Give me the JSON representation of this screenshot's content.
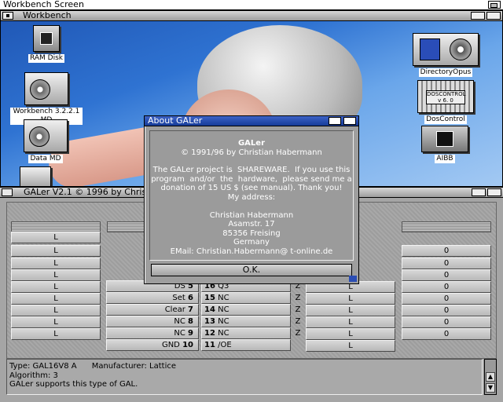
{
  "screen": {
    "title": "Workbench Screen"
  },
  "workbench": {
    "title": "Workbench",
    "icons": [
      {
        "label": "RAM Disk"
      },
      {
        "label": "Workbench 3.2.2.1 MD"
      },
      {
        "label": "Data MD"
      },
      {
        "label": "DirectoryOpus"
      },
      {
        "label": "DosControl"
      },
      {
        "label": "AIBB"
      }
    ],
    "doscontrol_text": "DOSCONTROL",
    "doscontrol_version": "v 6. 0"
  },
  "about": {
    "title": "About GALer",
    "heading": "GALer",
    "lines": [
      "© 1991/96 by Christian Habermann",
      "",
      "The GALer project is  SHAREWARE.  If you use this",
      "program  and/or  the  hardware,  please send me a",
      "donation of 15 US $ (see manual). Thank you!",
      "My address:",
      "",
      "Christian Habermann",
      "Asamstr. 17",
      "85356 Freising",
      "Germany",
      "EMail: Christian.Habermann@ t-online.de"
    ],
    "ok_label": "O.K."
  },
  "galer": {
    "title": "GALer V2.1  © 1996 by Christian Habermann",
    "left_values": [
      "L",
      "L",
      "L",
      "L",
      "L",
      "L",
      "L",
      "L",
      "L",
      "L"
    ],
    "right_values": [
      "0",
      "0",
      "0",
      "0",
      "0",
      "0",
      "0",
      "0"
    ],
    "mid_values": [
      "L",
      "L",
      "L",
      "L",
      "L"
    ],
    "pins_left": [
      {
        "name": "",
        "num": ""
      },
      {
        "name": "",
        "num": ""
      },
      {
        "name": "",
        "num": ""
      },
      {
        "name": "",
        "num": ""
      },
      {
        "name": "",
        "num": ""
      },
      {
        "name": "DS",
        "num": "5"
      },
      {
        "name": "Set",
        "num": "6"
      },
      {
        "name": "Clear",
        "num": "7"
      },
      {
        "name": "NC",
        "num": "8"
      },
      {
        "name": "NC",
        "num": "9"
      },
      {
        "name": "GND",
        "num": "10"
      }
    ],
    "pins_right": [
      {
        "num": "16",
        "name": "Q3"
      },
      {
        "num": "15",
        "name": "NC"
      },
      {
        "num": "14",
        "name": "NC"
      },
      {
        "num": "13",
        "name": "NC"
      },
      {
        "num": "12",
        "name": "NC"
      },
      {
        "num": "11",
        "name": "/OE"
      }
    ],
    "z_label": "Z",
    "status_lines": [
      "Type: GAL16V8 A      Manufacturer: Lattice",
      "Algorithm: 3",
      "GALer supports this type of GAL."
    ]
  }
}
